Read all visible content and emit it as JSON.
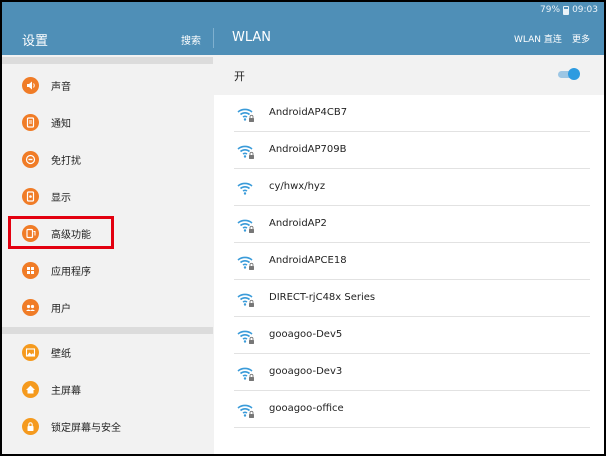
{
  "status_bar": {
    "battery": "79%",
    "time": "09:03"
  },
  "header": {
    "left_title": "设置",
    "search_label": "搜索",
    "right_title": "WLAN",
    "wlan_direct_label": "WLAN 直连",
    "more_label": "更多"
  },
  "sidebar": {
    "items": [
      {
        "label": "声音",
        "icon": "speaker-icon",
        "color": "#f07c27"
      },
      {
        "label": "通知",
        "icon": "notification-icon",
        "color": "#f07c27"
      },
      {
        "label": "免打扰",
        "icon": "do-not-disturb-icon",
        "color": "#f07c27"
      },
      {
        "label": "显示",
        "icon": "display-icon",
        "color": "#f07c27"
      },
      {
        "label": "高级功能",
        "icon": "advanced-features-icon",
        "color": "#f07c27"
      },
      {
        "label": "应用程序",
        "icon": "apps-icon",
        "color": "#f07c27"
      },
      {
        "label": "用户",
        "icon": "users-icon",
        "color": "#f07c27"
      },
      {
        "label": "壁纸",
        "icon": "wallpaper-icon",
        "color": "#f59a1e"
      },
      {
        "label": "主屏幕",
        "icon": "home-icon",
        "color": "#f59a1e"
      },
      {
        "label": "锁定屏幕与安全",
        "icon": "lock-icon",
        "color": "#f59a1e"
      }
    ]
  },
  "wlan": {
    "toggle_label": "开",
    "enabled": true,
    "networks": [
      {
        "ssid": "AndroidAP4CB7",
        "secured": true
      },
      {
        "ssid": "AndroidAP709B",
        "secured": true
      },
      {
        "ssid": "cy/hwx/hyz",
        "secured": false
      },
      {
        "ssid": "AndroidAP2",
        "secured": true
      },
      {
        "ssid": "AndroidAPCE18",
        "secured": true
      },
      {
        "ssid": "DIRECT-rjC48x Series",
        "secured": true
      },
      {
        "ssid": "gooagoo-Dev5",
        "secured": true
      },
      {
        "ssid": "gooagoo-Dev3",
        "secured": true
      },
      {
        "ssid": "gooagoo-office",
        "secured": true
      }
    ]
  },
  "colors": {
    "app_bar": "#4f8fb7",
    "accent": "#2d9be0",
    "highlight_box": "#e3000f"
  }
}
